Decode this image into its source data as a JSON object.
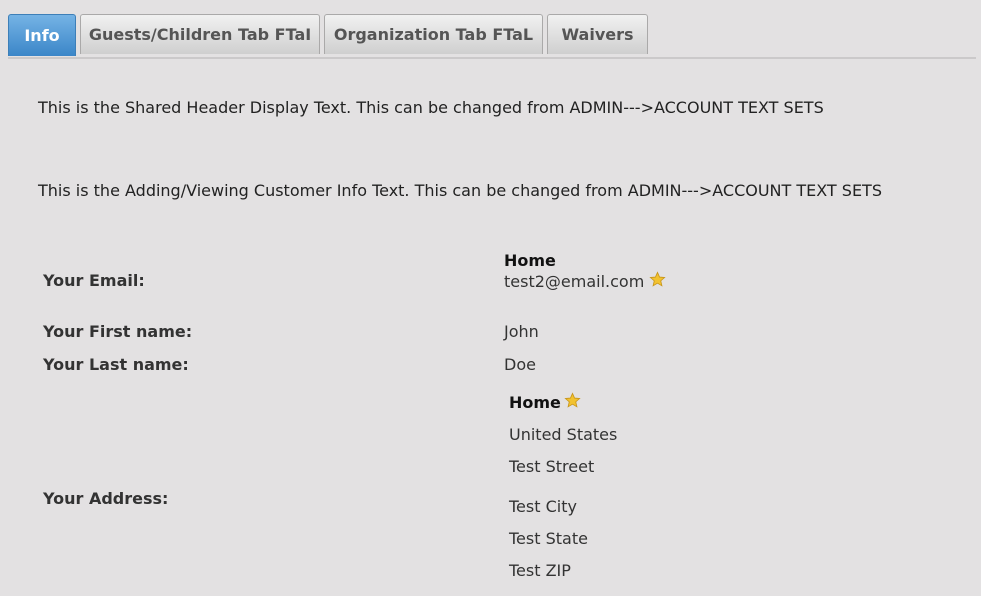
{
  "tabs": [
    "Info",
    "Guests/Children Tab FTaI",
    "Organization Tab FTaL",
    "Waivers"
  ],
  "header_text": "This is the Shared Header Display Text. This can be changed from ADMIN--->ACCOUNT TEXT SETS",
  "info_text": "This is the Adding/Viewing Customer Info Text. This can be changed from ADMIN--->ACCOUNT TEXT SETS",
  "email": {
    "label": "Your Email:",
    "type": "Home",
    "value": "test2@email.com"
  },
  "first_name": {
    "label": "Your First name:",
    "value": "John"
  },
  "last_name": {
    "label": "Your Last name:",
    "value": "Doe"
  },
  "address": {
    "label": "Your Address:",
    "type": "Home",
    "country": "United States",
    "street": "Test Street",
    "city": "Test City",
    "state": "Test State",
    "zip": "Test ZIP"
  },
  "colors": {
    "active_tab": "#4a94d2",
    "star": "#f2c230",
    "background": "#e3e1e2"
  },
  "icons": [
    "star-icon"
  ]
}
